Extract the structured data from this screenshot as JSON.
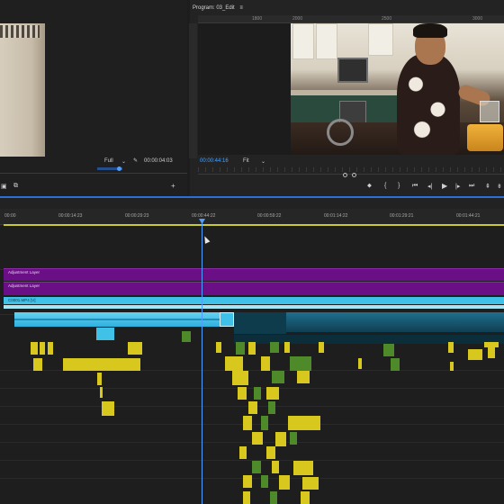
{
  "source_monitor": {
    "zoom_value": "Full",
    "timecode": "00:00:04:03"
  },
  "program_monitor": {
    "title": "Program: 03_Edit",
    "menu_glyph": "≡",
    "ruler_labels": [
      "1800",
      "2000",
      "2500",
      "3000"
    ],
    "timecode": "00:00:44:16",
    "zoom_value": "Fit"
  },
  "timeline": {
    "ruler_ticks": [
      "00:00",
      "00:00:14:23",
      "00:00:29:23",
      "00:00:44:22",
      "00:00:59:22",
      "00:01:14:22",
      "00:01:29:21",
      "00:01:44:21"
    ],
    "adjustment_label_1": "Adjustment Layer",
    "adjustment_label_2": "Adjustment Layer",
    "cyan_clip_label": "C0001.MP4 [V]"
  },
  "colors": {
    "accent_blue": "#4f9fff",
    "adjustment_purple": "#6b0f86",
    "video_cyan": "#3fc1e8",
    "audio_yellow": "#d8c81e",
    "audio_green": "#4f8a2a",
    "work_area": "#c9c932"
  },
  "icons": {
    "wrench": "wrench-icon",
    "export_frame": "camera-icon",
    "add": "plus-icon",
    "marker": "marker-icon",
    "play": "play-icon"
  }
}
